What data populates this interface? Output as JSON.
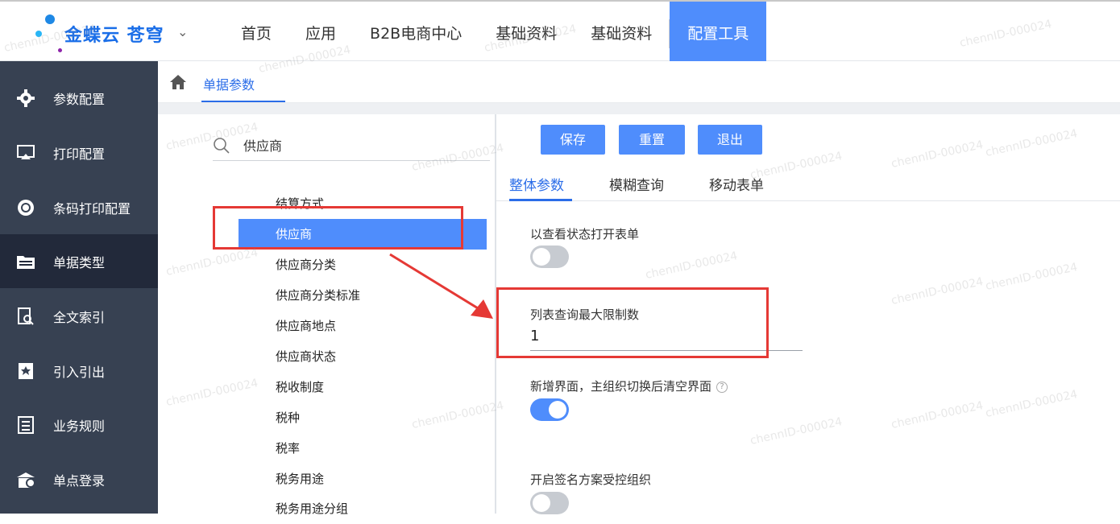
{
  "header": {
    "brand": "金蝶云 苍穹",
    "nav": [
      "首页",
      "应用",
      "B2B电商中心",
      "基础资料",
      "基础资料",
      "配置工具"
    ]
  },
  "sidebar": {
    "items": [
      {
        "label": "参数配置",
        "icon": "gear-icon"
      },
      {
        "label": "打印配置",
        "icon": "print-icon"
      },
      {
        "label": "条码打印配置",
        "icon": "circle-icon"
      },
      {
        "label": "单据类型",
        "icon": "folder-icon"
      },
      {
        "label": "全文索引",
        "icon": "search-doc-icon"
      },
      {
        "label": "引入引出",
        "icon": "import-export-icon"
      },
      {
        "label": "业务规则",
        "icon": "rules-icon"
      },
      {
        "label": "单点登录",
        "icon": "sso-icon"
      }
    ]
  },
  "breadcrumb": {
    "current": "单据参数"
  },
  "search": {
    "value": "供应商"
  },
  "tree": {
    "items": [
      "结算方式",
      "供应商",
      "供应商分类",
      "供应商分类标准",
      "供应商地点",
      "供应商状态",
      "税收制度",
      "税种",
      "税率",
      "税务用途",
      "税务用途分组"
    ]
  },
  "toolbar": {
    "save": "保存",
    "reset": "重置",
    "exit": "退出"
  },
  "tabs": [
    "整体参数",
    "模糊查询",
    "移动表单"
  ],
  "params": {
    "view_mode_label": "以查看状态打开表单",
    "view_mode_on": false,
    "max_limit_label": "列表查询最大限制数",
    "max_limit_value": "1",
    "clear_on_switch_label": "新增界面，主组织切换后清空界面",
    "clear_on_switch_on": true,
    "sign_control_label": "开启签名方案受控组织",
    "sign_control_on": false
  },
  "watermark": "chennID-000024",
  "colors": {
    "accent": "#4f8dfc",
    "sidebar": "#374152",
    "annotation": "#e53935"
  }
}
